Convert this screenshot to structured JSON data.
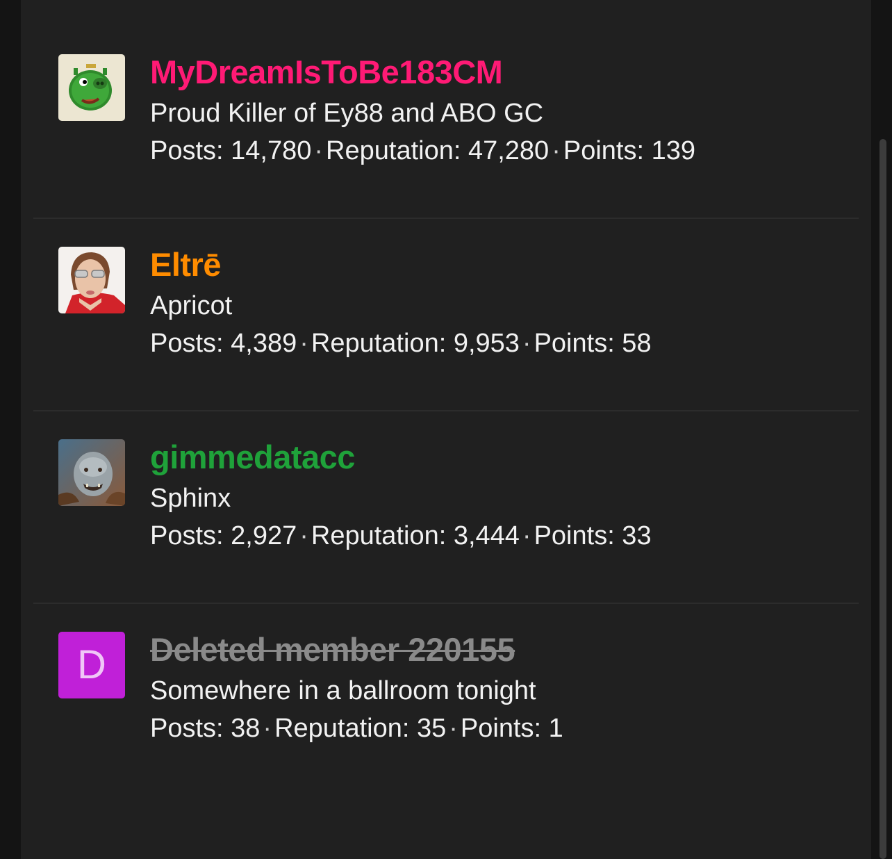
{
  "members": [
    {
      "username": "MyDreamIsToBe183CM",
      "username_color": "#ff1a75",
      "title": "Proud Killer of Ey88 and ABO GC",
      "posts_label": "Posts: 14,780",
      "reputation_label": "Reputation: 47,280",
      "points_label": "Points: 139",
      "avatar_icon": "green-pig-avatar"
    },
    {
      "username": "Eltrē",
      "username_color": "#ff8c00",
      "title": "Apricot",
      "posts_label": "Posts: 4,389",
      "reputation_label": "Reputation: 9,953",
      "points_label": "Points: 58",
      "avatar_icon": "woman-photo-avatar"
    },
    {
      "username": "gimmedatacc",
      "username_color": "#1fa23a",
      "title": "Sphinx",
      "posts_label": "Posts: 2,927",
      "reputation_label": "Reputation: 3,444",
      "points_label": "Points: 33",
      "avatar_icon": "orc-avatar"
    },
    {
      "username": "Deleted member 220155",
      "username_color": "#8a8a8a",
      "title": "Somewhere in a ballroom tonight",
      "posts_label": "Posts: 38",
      "reputation_label": "Reputation: 35",
      "points_label": "Points: 1",
      "avatar_letter": "D",
      "avatar_color": "#c020d8"
    }
  ],
  "separator": "·"
}
